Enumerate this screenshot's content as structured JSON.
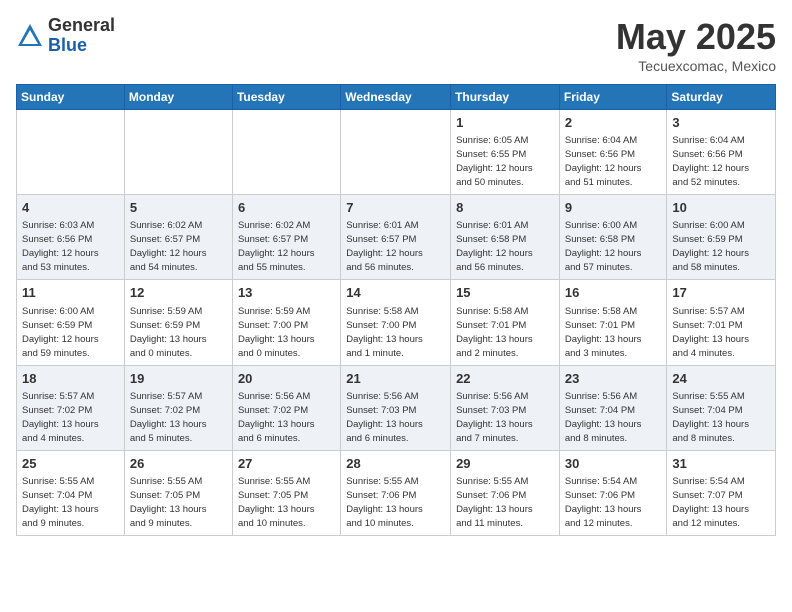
{
  "header": {
    "logo_general": "General",
    "logo_blue": "Blue",
    "month_title": "May 2025",
    "location": "Tecuexcomac, Mexico"
  },
  "weekdays": [
    "Sunday",
    "Monday",
    "Tuesday",
    "Wednesday",
    "Thursday",
    "Friday",
    "Saturday"
  ],
  "weeks": [
    [
      {
        "day": "",
        "info": ""
      },
      {
        "day": "",
        "info": ""
      },
      {
        "day": "",
        "info": ""
      },
      {
        "day": "",
        "info": ""
      },
      {
        "day": "1",
        "info": "Sunrise: 6:05 AM\nSunset: 6:55 PM\nDaylight: 12 hours\nand 50 minutes."
      },
      {
        "day": "2",
        "info": "Sunrise: 6:04 AM\nSunset: 6:56 PM\nDaylight: 12 hours\nand 51 minutes."
      },
      {
        "day": "3",
        "info": "Sunrise: 6:04 AM\nSunset: 6:56 PM\nDaylight: 12 hours\nand 52 minutes."
      }
    ],
    [
      {
        "day": "4",
        "info": "Sunrise: 6:03 AM\nSunset: 6:56 PM\nDaylight: 12 hours\nand 53 minutes."
      },
      {
        "day": "5",
        "info": "Sunrise: 6:02 AM\nSunset: 6:57 PM\nDaylight: 12 hours\nand 54 minutes."
      },
      {
        "day": "6",
        "info": "Sunrise: 6:02 AM\nSunset: 6:57 PM\nDaylight: 12 hours\nand 55 minutes."
      },
      {
        "day": "7",
        "info": "Sunrise: 6:01 AM\nSunset: 6:57 PM\nDaylight: 12 hours\nand 56 minutes."
      },
      {
        "day": "8",
        "info": "Sunrise: 6:01 AM\nSunset: 6:58 PM\nDaylight: 12 hours\nand 56 minutes."
      },
      {
        "day": "9",
        "info": "Sunrise: 6:00 AM\nSunset: 6:58 PM\nDaylight: 12 hours\nand 57 minutes."
      },
      {
        "day": "10",
        "info": "Sunrise: 6:00 AM\nSunset: 6:59 PM\nDaylight: 12 hours\nand 58 minutes."
      }
    ],
    [
      {
        "day": "11",
        "info": "Sunrise: 6:00 AM\nSunset: 6:59 PM\nDaylight: 12 hours\nand 59 minutes."
      },
      {
        "day": "12",
        "info": "Sunrise: 5:59 AM\nSunset: 6:59 PM\nDaylight: 13 hours\nand 0 minutes."
      },
      {
        "day": "13",
        "info": "Sunrise: 5:59 AM\nSunset: 7:00 PM\nDaylight: 13 hours\nand 0 minutes."
      },
      {
        "day": "14",
        "info": "Sunrise: 5:58 AM\nSunset: 7:00 PM\nDaylight: 13 hours\nand 1 minute."
      },
      {
        "day": "15",
        "info": "Sunrise: 5:58 AM\nSunset: 7:01 PM\nDaylight: 13 hours\nand 2 minutes."
      },
      {
        "day": "16",
        "info": "Sunrise: 5:58 AM\nSunset: 7:01 PM\nDaylight: 13 hours\nand 3 minutes."
      },
      {
        "day": "17",
        "info": "Sunrise: 5:57 AM\nSunset: 7:01 PM\nDaylight: 13 hours\nand 4 minutes."
      }
    ],
    [
      {
        "day": "18",
        "info": "Sunrise: 5:57 AM\nSunset: 7:02 PM\nDaylight: 13 hours\nand 4 minutes."
      },
      {
        "day": "19",
        "info": "Sunrise: 5:57 AM\nSunset: 7:02 PM\nDaylight: 13 hours\nand 5 minutes."
      },
      {
        "day": "20",
        "info": "Sunrise: 5:56 AM\nSunset: 7:02 PM\nDaylight: 13 hours\nand 6 minutes."
      },
      {
        "day": "21",
        "info": "Sunrise: 5:56 AM\nSunset: 7:03 PM\nDaylight: 13 hours\nand 6 minutes."
      },
      {
        "day": "22",
        "info": "Sunrise: 5:56 AM\nSunset: 7:03 PM\nDaylight: 13 hours\nand 7 minutes."
      },
      {
        "day": "23",
        "info": "Sunrise: 5:56 AM\nSunset: 7:04 PM\nDaylight: 13 hours\nand 8 minutes."
      },
      {
        "day": "24",
        "info": "Sunrise: 5:55 AM\nSunset: 7:04 PM\nDaylight: 13 hours\nand 8 minutes."
      }
    ],
    [
      {
        "day": "25",
        "info": "Sunrise: 5:55 AM\nSunset: 7:04 PM\nDaylight: 13 hours\nand 9 minutes."
      },
      {
        "day": "26",
        "info": "Sunrise: 5:55 AM\nSunset: 7:05 PM\nDaylight: 13 hours\nand 9 minutes."
      },
      {
        "day": "27",
        "info": "Sunrise: 5:55 AM\nSunset: 7:05 PM\nDaylight: 13 hours\nand 10 minutes."
      },
      {
        "day": "28",
        "info": "Sunrise: 5:55 AM\nSunset: 7:06 PM\nDaylight: 13 hours\nand 10 minutes."
      },
      {
        "day": "29",
        "info": "Sunrise: 5:55 AM\nSunset: 7:06 PM\nDaylight: 13 hours\nand 11 minutes."
      },
      {
        "day": "30",
        "info": "Sunrise: 5:54 AM\nSunset: 7:06 PM\nDaylight: 13 hours\nand 12 minutes."
      },
      {
        "day": "31",
        "info": "Sunrise: 5:54 AM\nSunset: 7:07 PM\nDaylight: 13 hours\nand 12 minutes."
      }
    ]
  ]
}
